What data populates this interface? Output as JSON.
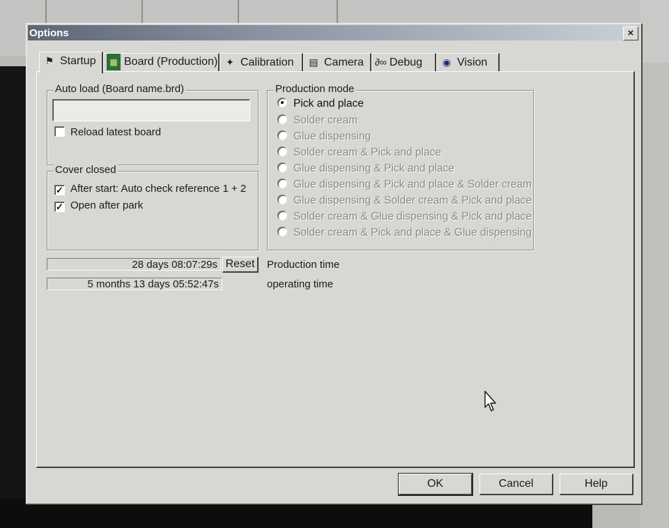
{
  "window": {
    "title": "Options",
    "close_symbol": "×"
  },
  "tabs": [
    {
      "label": "Startup",
      "icon": "startup-icon",
      "glyph": "⚑"
    },
    {
      "label": "Board (Production)",
      "icon": "board-icon",
      "glyph": "▦"
    },
    {
      "label": "Calibration",
      "icon": "calibration-icon",
      "glyph": "✦"
    },
    {
      "label": "Camera",
      "icon": "camera-icon",
      "glyph": "▤"
    },
    {
      "label": "Debug",
      "icon": "debug-icon",
      "glyph": "∂∞"
    },
    {
      "label": "Vision",
      "icon": "eye-icon",
      "glyph": "◉"
    }
  ],
  "active_tab": "Startup",
  "auto_load": {
    "label": "Auto load (Board name.brd)",
    "value": "",
    "reload_label": "Reload latest board",
    "reload_checked": false
  },
  "cover_closed": {
    "label": "Cover closed",
    "options": [
      {
        "label": "After start: Auto check reference 1 + 2",
        "checked": true
      },
      {
        "label": "Open after park",
        "checked": true
      }
    ]
  },
  "production_mode": {
    "label": "Production mode",
    "selected_index": 0,
    "options": [
      "Pick and place",
      "Solder cream",
      "Glue dispensing",
      "Solder cream & Pick and place",
      "Glue dispensing & Pick and place",
      "Glue dispensing & Pick and place & Solder cream",
      "Glue dispensing & Solder cream & Pick and place",
      "Solder cream & Glue dispensing & Pick and place",
      "Solder cream & Pick and place & Glue dispensing"
    ]
  },
  "timers": {
    "production_value": "28 days 08:07:29s",
    "reset_label": "Reset",
    "production_label": "Production time",
    "operating_value": "5 months 13 days 05:52:47s",
    "operating_label": "operating time"
  },
  "buttons": {
    "ok": "OK",
    "cancel": "Cancel",
    "help": "Help"
  },
  "colors": {
    "dialog_bg": "#d7d7d3",
    "titlebar_start": "#5c6674",
    "titlebar_end": "#c9d0d7"
  }
}
